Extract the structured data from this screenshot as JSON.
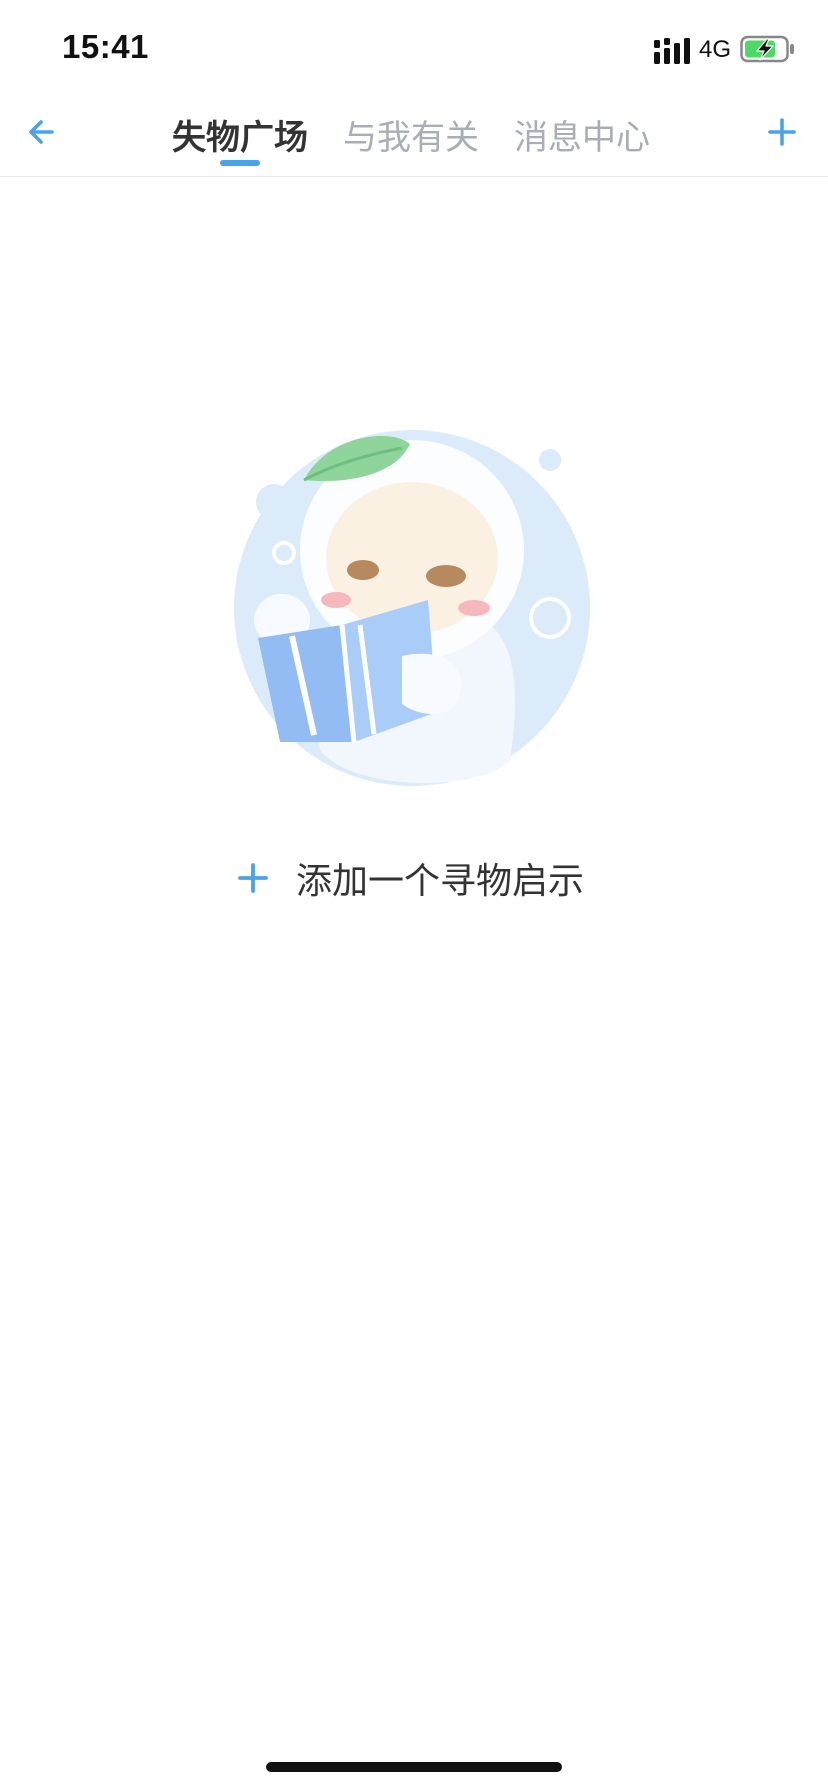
{
  "status_bar": {
    "time": "15:41",
    "network": "4G",
    "battery_charging": true
  },
  "nav": {
    "back_icon": "arrow-left-icon",
    "add_icon": "plus-icon",
    "tabs": [
      {
        "label": "失物广场",
        "active": true
      },
      {
        "label": "与我有关",
        "active": false
      },
      {
        "label": "消息中心",
        "active": false
      }
    ]
  },
  "empty_state": {
    "illustration": "reading-character-illustration",
    "add_label": "添加一个寻物启示",
    "add_icon": "plus-icon"
  },
  "colors": {
    "accent": "#4aa3e8",
    "text_primary": "#333333",
    "text_muted": "#a8aeb6",
    "battery_green": "#4cd964"
  }
}
